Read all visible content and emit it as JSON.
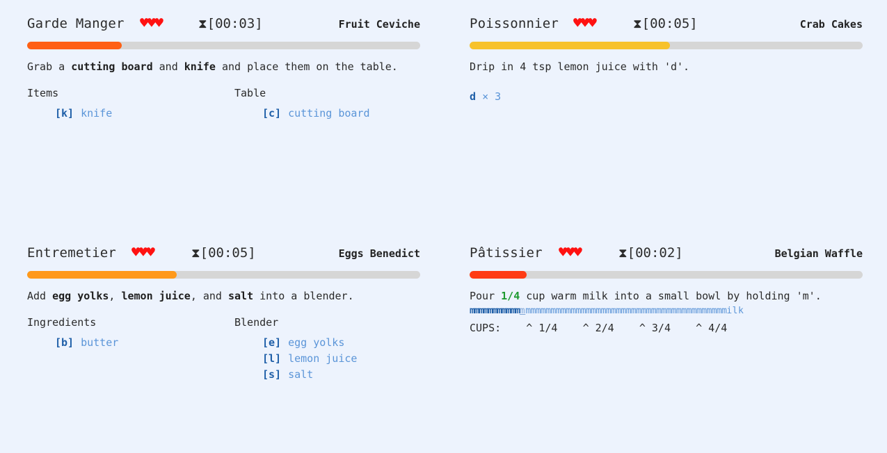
{
  "colors": {
    "background": "#edf3fd",
    "heart": "#ff1111",
    "bar_track": "#d6d6d6",
    "key": "#1f5fa8",
    "item": "#5b95d8",
    "highlight": "#1e9a30"
  },
  "stations": [
    {
      "name": "Garde Manger",
      "hearts": "♥♥♥",
      "timer_icon": "hourglass-icon",
      "timer": "[00:03]",
      "dish": "Fruit Ceviche",
      "progress": 0.24,
      "bar_color": "#ff6014",
      "instruction": {
        "p1": "Grab a ",
        "b1": "cutting board",
        "p2": " and ",
        "b2": "knife",
        "p3": " and place them on the table."
      },
      "left_title": "Items",
      "left_items": [
        {
          "key": "[k]",
          "name": "knife"
        }
      ],
      "right_title": "Table",
      "right_items": [
        {
          "key": "[c]",
          "name": "cutting board"
        }
      ]
    },
    {
      "name": "Poissonnier",
      "hearts": "♥♥♥",
      "timer_icon": "hourglass-icon",
      "timer": "[00:05]",
      "dish": "Crab Cakes",
      "progress": 0.51,
      "bar_color": "#f7c22b",
      "instruction": {
        "text": "Drip in 4 tsp lemon juice with 'd'."
      },
      "press": {
        "key": "d",
        "count": "× 3"
      }
    },
    {
      "name": "Entremetier",
      "hearts": "♥♥♥",
      "timer_icon": "hourglass-icon",
      "timer": "[00:05]",
      "dish": "Eggs Benedict",
      "progress": 0.38,
      "bar_color": "#ff991a",
      "instruction": {
        "p1": "Add ",
        "b1": "egg yolks",
        "p2": ", ",
        "b2": "lemon juice",
        "p3": ", and ",
        "b3": "salt",
        "p4": " into a blender."
      },
      "left_title": "Ingredients",
      "left_items": [
        {
          "key": "[b]",
          "name": "butter"
        }
      ],
      "right_title": "Blender",
      "right_items": [
        {
          "key": "[e]",
          "name": "egg yolks"
        },
        {
          "key": "[l]",
          "name": "lemon juice"
        },
        {
          "key": "[s]",
          "name": "salt"
        }
      ]
    },
    {
      "name": "Pâtissier",
      "hearts": "♥♥♥",
      "timer_icon": "hourglass-icon",
      "timer": "[00:02]",
      "dish": "Belgian Waffle",
      "progress": 0.145,
      "bar_color": "#ff3c14",
      "instruction": {
        "p1": "Pour ",
        "hl": "1/4",
        "p2": " cup warm milk into a small bowl by holding 'm'."
      },
      "hold": {
        "done": "mmmmmmmmmmm",
        "current": "m",
        "rest": "mmmmmmmmmmmmmmmmmmmmmmmmmmmmmmmmmmmmmmmm",
        "word": "ilk"
      },
      "cups_label": "CUPS:",
      "cups": [
        "^ 1/4",
        "^ 2/4",
        "^ 3/4",
        "^ 4/4"
      ]
    }
  ]
}
